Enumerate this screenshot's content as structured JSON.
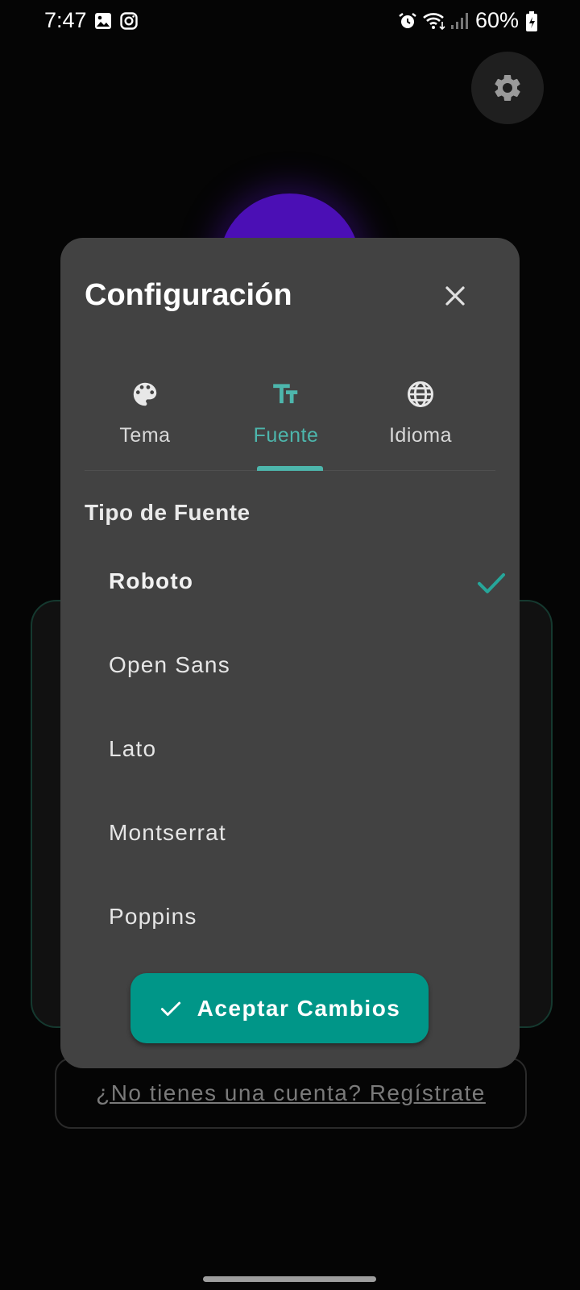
{
  "status_bar": {
    "time": "7:47",
    "battery": "60%"
  },
  "background": {
    "register_link": "¿No tienes una cuenta? Regístrate"
  },
  "dialog": {
    "title": "Configuración",
    "tabs": [
      {
        "label": "Tema",
        "icon": "palette-icon",
        "active": false
      },
      {
        "label": "Fuente",
        "icon": "text-fields-icon",
        "active": true
      },
      {
        "label": "Idioma",
        "icon": "globe-icon",
        "active": false
      }
    ],
    "section_title": "Tipo de Fuente",
    "fonts": [
      {
        "label": "Roboto",
        "selected": true
      },
      {
        "label": "Open Sans",
        "selected": false
      },
      {
        "label": "Lato",
        "selected": false
      },
      {
        "label": "Montserrat",
        "selected": false
      },
      {
        "label": "Poppins",
        "selected": false
      }
    ],
    "accept_label": "Aceptar Cambios"
  },
  "colors": {
    "accent": "#4db6ac",
    "button": "#009688",
    "dialog_bg": "#424242",
    "logo_purple": "#4b0fb5"
  }
}
